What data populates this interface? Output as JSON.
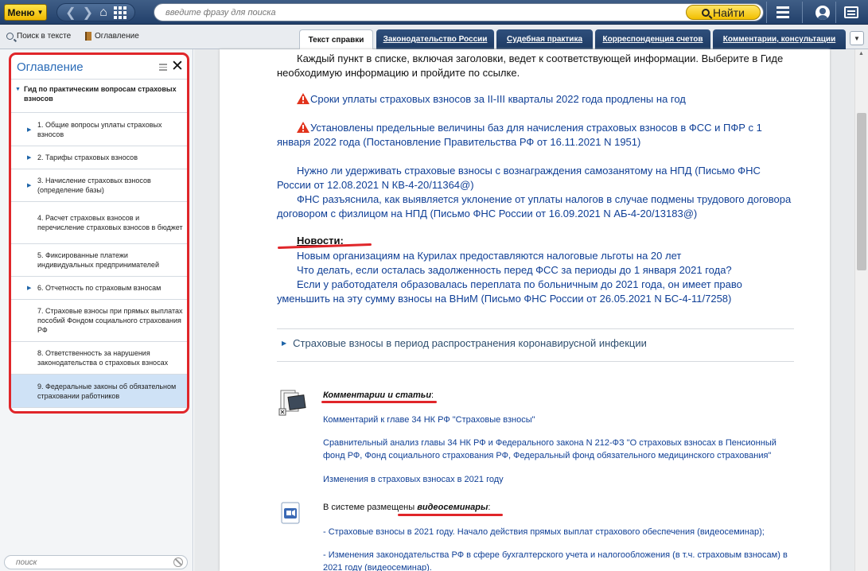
{
  "header": {
    "menu_label": "Меню",
    "search_placeholder": "введите фразу для поиска",
    "find_label": "Найти"
  },
  "subbar": {
    "search_in_text": "Поиск в тексте",
    "contents": "Оглавление",
    "tabs": [
      {
        "label": "Текст справки",
        "active": true
      },
      {
        "label": "Законодательство России",
        "active": false
      },
      {
        "label": "Судебная практика",
        "active": false
      },
      {
        "label": "Корреспонденция счетов",
        "active": false
      },
      {
        "label": "Комментарии, консультации",
        "active": false
      }
    ]
  },
  "toc": {
    "title": "Оглавление",
    "root": "Гид по практическим вопросам страховых взносов",
    "items": [
      {
        "label": "1. Общие вопросы уплаты страховых взносов",
        "expandable": true
      },
      {
        "label": "2. Тарифы страховых взносов",
        "expandable": true
      },
      {
        "label": "3. Начисление страховых взносов (определение базы)",
        "expandable": true
      },
      {
        "label": "4. Расчет страховых взносов и перечисление страховых взносов в бюджет",
        "expandable": false
      },
      {
        "label": "5. Фиксированные платежи индивидуальных предпринимателей",
        "expandable": false
      },
      {
        "label": "6. Отчетность по страховым взносам",
        "expandable": true
      },
      {
        "label": "7. Страховые взносы при прямых выплатах пособий Фондом социального страхования РФ",
        "expandable": false
      },
      {
        "label": "8. Ответственность за нарушения законодательства о страховых взносах",
        "expandable": false
      },
      {
        "label": "9. Федеральные законы об обязательном страховании работников",
        "expandable": false,
        "selected": true
      }
    ],
    "search_placeholder": "поиск"
  },
  "doc": {
    "intro": "Каждый пункт в списке, включая заголовки, ведет к соответствующей информации. Выберите в Гиде необходимую информацию и пройдите по ссылке.",
    "alert1": "Сроки уплаты страховых взносов за II-III кварталы 2022 года продлены на год",
    "alert2": "Установлены предельные величины баз для начисления страховых взносов в ФСС и ПФР с 1 января 2022 года (Постановление Правительства РФ от 16.11.2021 N 1951)",
    "link3": "Нужно ли удерживать страховые взносы с вознаграждения самозанятому на НПД (Письмо ФНС России от 12.08.2021 N КВ-4-20/11364@)",
    "link4": "ФНС разъяснила, как выявляется уклонение от уплаты налогов в случае подмены трудового договора договором с физлицом на НПД (Письмо ФНС России от 16.09.2021 N АБ-4-20/13183@)",
    "news_heading": "Новости",
    "news": [
      "Новым организациям на Курилах предоставляются налоговые льготы на 20 лет",
      "Что делать, если осталась задолженность перед ФСС за периоды до 1 января 2021 года?",
      "Если у работодателя образовалась переплата по больничным до 2021 года, он имеет право уменьшить на эту сумму взносы на ВНиМ (Письмо ФНС России от 26.05.2021 N БС-4-11/7258)"
    ],
    "covid_link": "Страховые взносы в период распространения коронавирусной инфекции",
    "comments_heading": "Комментарии и статьи",
    "comments": [
      "Комментарий к главе 34 НК РФ \"Страховые взносы\"",
      "Сравнительный анализ главы 34 НК РФ и Федерального закона N 212-ФЗ \"О страховых взносах в Пенсионный фонд РФ, Фонд социального страхования РФ, Федеральный фонд обязательного медицинского страхования\"",
      "Изменения в страховых взносах в 2021 году"
    ],
    "video_prefix": "В системе размещены",
    "video_heading": "видеосеминары",
    "videos": [
      "- Страховые взносы в 2021 году. Начало действия прямых выплат страхового обеспечения (видеосеминар);",
      "- Изменения законодательства РФ в сфере бухгалтерского учета и налогообложения (в т.ч. страховым взносам) в 2021 году (видеосеминар)."
    ]
  }
}
